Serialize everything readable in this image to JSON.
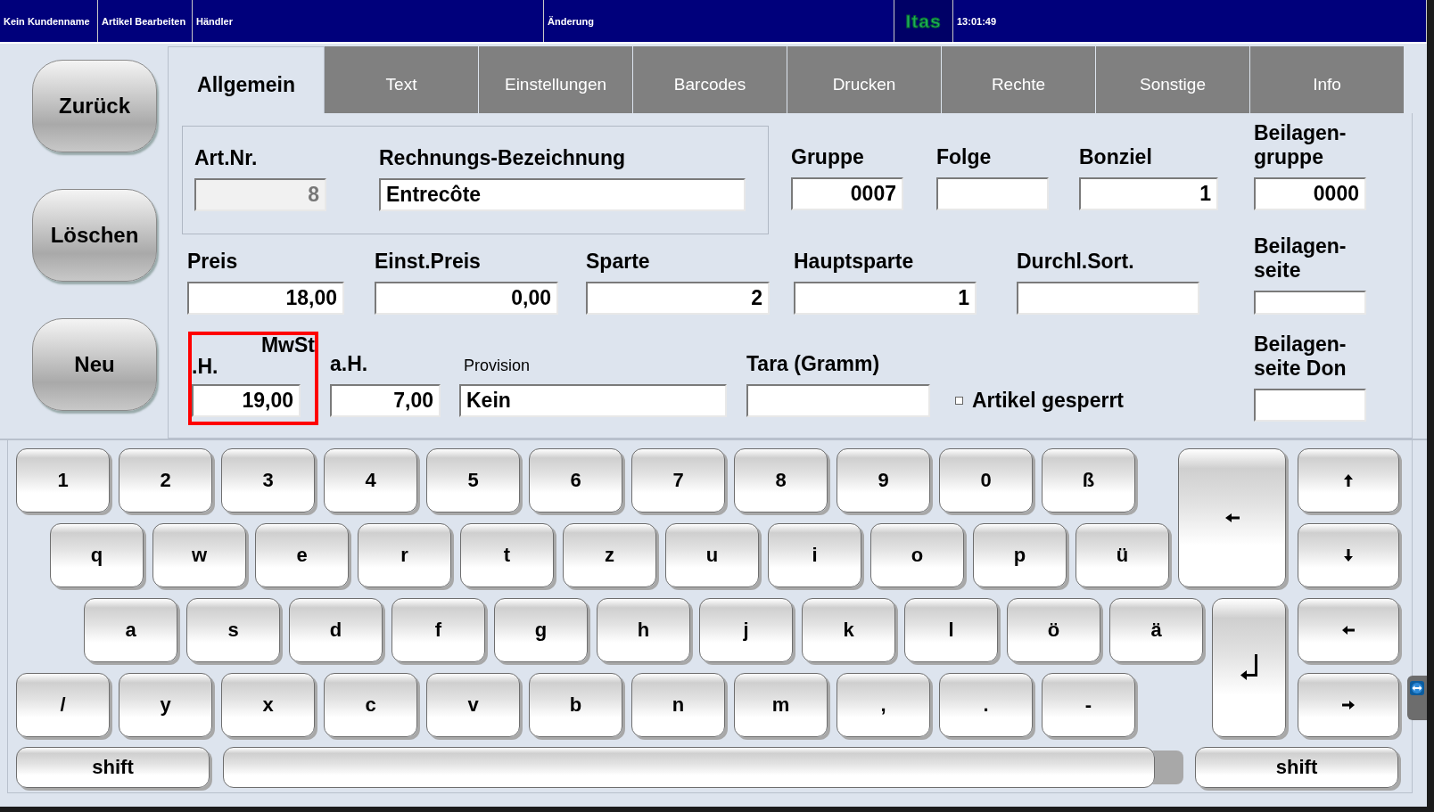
{
  "status_bar": {
    "customer": "Kein Kundenname",
    "mode": "Artikel Bearbeiten",
    "dealer": "Händler",
    "change": "Änderung",
    "logo": "Itas",
    "time": "13:01:49"
  },
  "side_buttons": [
    "Zurück",
    "Löschen",
    "Neu"
  ],
  "tabs": [
    {
      "label": "Allgemein",
      "selected": true
    },
    {
      "label": "Text",
      "selected": false
    },
    {
      "label": "Einstellungen",
      "selected": false
    },
    {
      "label": "Barcodes",
      "selected": false
    },
    {
      "label": "Drucken",
      "selected": false
    },
    {
      "label": "Rechte",
      "selected": false
    },
    {
      "label": "Sonstige",
      "selected": false
    },
    {
      "label": "Info",
      "selected": false
    }
  ],
  "form": {
    "box_fields": [
      {
        "label_lines": [
          "Art.Nr."
        ],
        "value": "8",
        "kind": "number",
        "readonly": true,
        "small_label": false,
        "highlighted": false
      },
      {
        "label_lines": [
          "Rechnungs-Bezeichnung"
        ],
        "value": "Entrecôte",
        "kind": "text",
        "readonly": false,
        "small_label": false,
        "highlighted": false
      }
    ],
    "row_1": [
      {
        "label_lines": [
          "Gruppe"
        ],
        "value": "0007",
        "kind": "number",
        "readonly": false,
        "small_label": false,
        "highlighted": false
      },
      {
        "label_lines": [
          "Folge"
        ],
        "kind": "number",
        "readonly": false,
        "small_label": false,
        "highlighted": false
      },
      {
        "label_lines": [
          "Bonziel"
        ],
        "value": "1",
        "kind": "number",
        "readonly": false,
        "small_label": false,
        "highlighted": false
      },
      {
        "label_lines": [
          "Beilagen-",
          "gruppe"
        ],
        "value": "0000",
        "kind": "number",
        "readonly": false,
        "small_label": false,
        "highlighted": false
      }
    ],
    "row_2": [
      {
        "label_lines": [
          "Preis"
        ],
        "value": "18,00",
        "kind": "number",
        "readonly": false,
        "small_label": false,
        "highlighted": false
      },
      {
        "label_lines": [
          "Einst.Preis"
        ],
        "value": "0,00",
        "kind": "number",
        "readonly": false,
        "small_label": false,
        "highlighted": false
      },
      {
        "label_lines": [
          "Sparte"
        ],
        "value": "2",
        "kind": "number",
        "readonly": false,
        "small_label": false,
        "highlighted": false
      },
      {
        "label_lines": [
          "Hauptsparte"
        ],
        "value": "1",
        "kind": "number",
        "readonly": false,
        "small_label": false,
        "highlighted": false
      },
      {
        "label_lines": [
          "Durchl.Sort."
        ],
        "kind": "text",
        "readonly": false,
        "small_label": false,
        "highlighted": false
      },
      {
        "label_lines": [
          "Beilagen-",
          "seite"
        ],
        "kind": "text",
        "readonly": false,
        "small_label": false,
        "highlighted": false
      }
    ],
    "row_3": [
      {
        "label_lines": [
          "MwSt",
          ".H."
        ],
        "value": "19,00",
        "kind": "number",
        "readonly": false,
        "small_label": false,
        "highlighted": true
      },
      {
        "label_lines": [
          "a.H."
        ],
        "value": "7,00",
        "kind": "number",
        "readonly": false,
        "small_label": false,
        "highlighted": false
      },
      {
        "label_lines": [
          "Provision"
        ],
        "value": "Kein",
        "kind": "text",
        "readonly": false,
        "small_label": true,
        "highlighted": false
      },
      {
        "label_lines": [
          "Tara (Gramm)"
        ],
        "kind": "text",
        "readonly": false,
        "small_label": false,
        "highlighted": false
      },
      {
        "kind": "checkbox",
        "label": "Artikel gesperrt",
        "checked": false
      },
      {
        "label_lines": [
          "Beilagen-",
          "seite Don"
        ],
        "kind": "text",
        "readonly": false,
        "small_label": false,
        "highlighted": false
      }
    ]
  },
  "keyboard": {
    "rows": [
      [
        "1",
        "2",
        "3",
        "4",
        "5",
        "6",
        "7",
        "8",
        "9",
        "0",
        "ß"
      ],
      [
        "q",
        "w",
        "e",
        "r",
        "t",
        "z",
        "u",
        "i",
        "o",
        "p",
        "ü"
      ],
      [
        "a",
        "s",
        "d",
        "f",
        "g",
        "h",
        "j",
        "k",
        "l",
        "ö",
        "ä"
      ],
      [
        "/",
        "y",
        "x",
        "c",
        "v",
        "b",
        "n",
        "m",
        ",",
        ".",
        "-"
      ]
    ],
    "shift_left": "shift",
    "shift_right": "shift"
  }
}
